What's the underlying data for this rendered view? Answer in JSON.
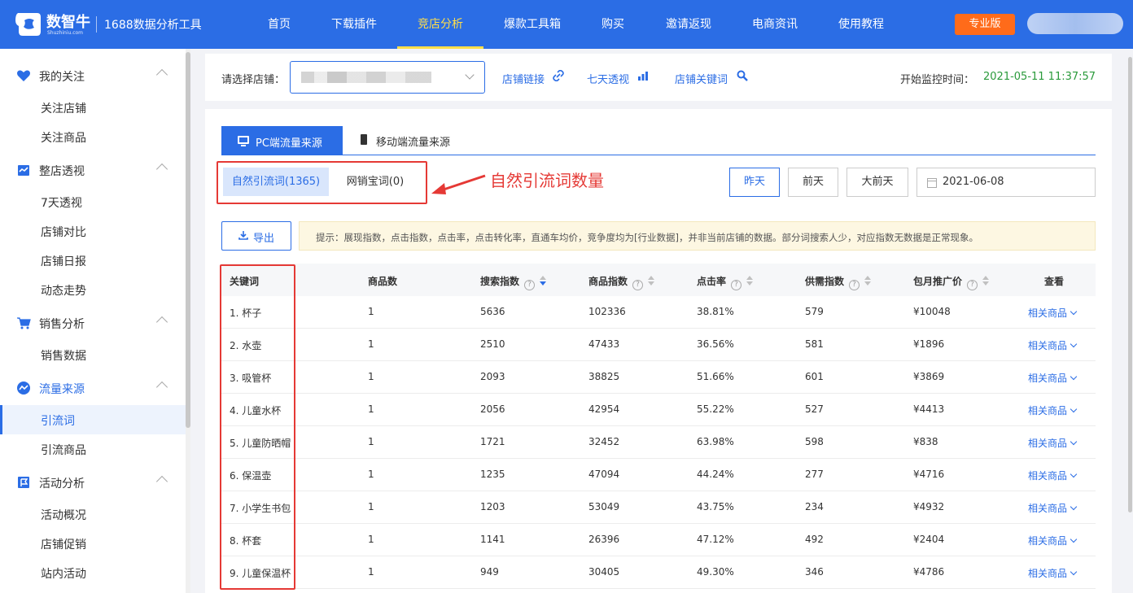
{
  "header": {
    "brand": "数智牛",
    "brand_sub": "Shuzhiniu.com",
    "product": "1688数据分析工具",
    "nav": [
      "首页",
      "下载插件",
      "竞店分析",
      "爆款工具箱",
      "购买",
      "邀请返现",
      "电商资讯",
      "使用教程"
    ],
    "active_nav_index": 2,
    "pro_button": "专业版",
    "colors": {
      "bar": "#2b6de5",
      "active": "#ffdf4a",
      "pro": "#ff6b1a"
    }
  },
  "sidebar": {
    "groups": [
      {
        "label": "我的关注",
        "icon": "heart-icon",
        "items": [
          "关注店铺",
          "关注商品"
        ]
      },
      {
        "label": "整店透视",
        "icon": "store-icon",
        "items": [
          "7天透视",
          "店铺对比",
          "店铺日报",
          "动态走势"
        ]
      },
      {
        "label": "销售分析",
        "icon": "cart-icon",
        "items": [
          "销售数据"
        ]
      },
      {
        "label": "流量来源",
        "icon": "trend-icon",
        "items": [
          "引流词",
          "引流商品"
        ]
      },
      {
        "label": "活动分析",
        "icon": "flag-icon",
        "items": [
          "活动概况",
          "店铺促销",
          "站内活动"
        ]
      }
    ],
    "active_item": "引流词"
  },
  "filter": {
    "shop_label": "请选择店铺：",
    "links": [
      "店铺链接",
      "七天透视",
      "店铺关键词"
    ],
    "monitor_label": "开始监控时间：",
    "monitor_value": "2021-05-11 11:37:57"
  },
  "tabs": {
    "pc": "PC端流量来源",
    "mobile": "移动端流量来源"
  },
  "segments": {
    "natural": "自然引流词(1365)",
    "bestseller": "网销宝词(0)"
  },
  "annotation": "自然引流词数量",
  "days": [
    "昨天",
    "前天",
    "大前天"
  ],
  "date": "2021-06-08",
  "export": "导出",
  "tip": "提示：展现指数，点击指数，点击率，点击转化率，直通车均价，竞争度均为[行业数据]，并非当前店铺的数据。部分词搜索人少，对应指数无数据是正常现象。",
  "table": {
    "headers": [
      "关键词",
      "商品数",
      "搜索指数",
      "商品指数",
      "点击率",
      "供需指数",
      "包月推广价",
      "查看"
    ],
    "link_text": "相关商品",
    "rows": [
      [
        "1. 杯子",
        "1",
        "5636",
        "102336",
        "38.81%",
        "579",
        "¥10048"
      ],
      [
        "2. 水壶",
        "1",
        "2510",
        "47433",
        "36.56%",
        "581",
        "¥1896"
      ],
      [
        "3. 吸管杯",
        "1",
        "2093",
        "38825",
        "51.66%",
        "601",
        "¥3869"
      ],
      [
        "4. 儿童水杯",
        "1",
        "2056",
        "42954",
        "55.22%",
        "527",
        "¥4413"
      ],
      [
        "5. 儿童防晒帽",
        "1",
        "1721",
        "32452",
        "63.98%",
        "598",
        "¥838"
      ],
      [
        "6. 保温壶",
        "1",
        "1235",
        "47094",
        "44.24%",
        "277",
        "¥4716"
      ],
      [
        "7. 小学生书包",
        "1",
        "1203",
        "53049",
        "43.75%",
        "234",
        "¥4932"
      ],
      [
        "8. 杯套",
        "1",
        "1141",
        "26396",
        "47.12%",
        "492",
        "¥2404"
      ],
      [
        "9. 儿童保温杯",
        "1",
        "949",
        "30405",
        "49.30%",
        "346",
        "¥4786"
      ]
    ]
  }
}
